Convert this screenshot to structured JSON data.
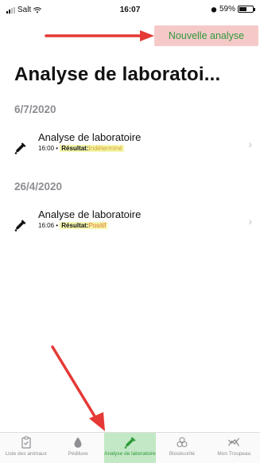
{
  "status_bar": {
    "carrier": "Salt",
    "time": "16:07",
    "battery": "59%",
    "battery_level": 0.59
  },
  "header": {
    "new_analysis_label": "Nouvelle analyse",
    "title": "Analyse de laboratoi..."
  },
  "sections": [
    {
      "date": "6/7/2020",
      "items": [
        {
          "title": "Analyse de laboratoire",
          "time": "16:00",
          "result_label": "Résultat:",
          "result_value": "Indéterminé"
        }
      ]
    },
    {
      "date": "26/4/2020",
      "items": [
        {
          "title": "Analyse de laboratoire",
          "time": "16:06",
          "result_label": "Résultat:",
          "result_value": "Positif"
        }
      ]
    }
  ],
  "tabs": [
    {
      "label": "Liste des animaux",
      "icon": "clipboard-check-icon",
      "active": false
    },
    {
      "label": "Pédiluve",
      "icon": "drop-icon",
      "active": false
    },
    {
      "label": "Analyse de laboratoire",
      "icon": "pipette-icon",
      "active": true
    },
    {
      "label": "Biosécurité",
      "icon": "biohazard-icon",
      "active": false
    },
    {
      "label": "Mon Troupeau",
      "icon": "trend-chart-icon",
      "active": false
    }
  ],
  "colors": {
    "accent": "#2e9a3a",
    "highlight_button": "#f6c9c9",
    "active_tab": "#c3e8c5",
    "arrow": "#e53935"
  }
}
